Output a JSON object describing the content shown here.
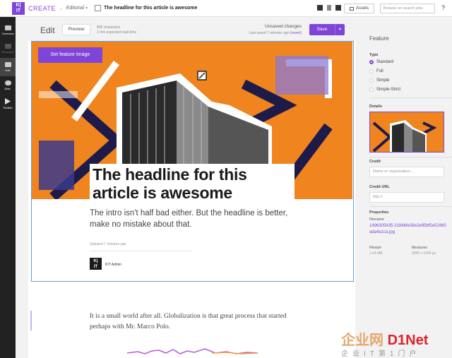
{
  "app": {
    "name": "CREATE",
    "logo_text_top": "K|",
    "logo_text_bottom": "IT"
  },
  "breadcrumb": {
    "section": "Editorial",
    "doc_title": "The headline for this article is awesome"
  },
  "topbar": {
    "assets_label": "Assets",
    "search_placeholder": "Browse on search jobs",
    "help": "?"
  },
  "nav": [
    {
      "label": "Overview",
      "icon": "eye-icon",
      "state": "normal"
    },
    {
      "label": "Research",
      "icon": "flask-icon",
      "state": "dim"
    },
    {
      "label": "Edit",
      "icon": "pencil-icon",
      "state": "active"
    },
    {
      "label": "Distr.",
      "icon": "cloud-icon",
      "state": "normal"
    },
    {
      "label": "Publish",
      "icon": "play-icon",
      "state": "normal"
    }
  ],
  "editor": {
    "title": "Edit",
    "preview_label": "Preview",
    "characters": "893 characters",
    "read_time": "1 min expected read time",
    "status": "Unsaved changes",
    "last_saved": "Last saved 7 minutes ago",
    "revert": "(revert)",
    "save_label": "Save"
  },
  "article": {
    "feature_button": "Set feature Image",
    "headline": "The headline for this article is awesome",
    "intro": "The intro isn't half bad either. But the headline is better, make no mistake about that.",
    "updated": "Updated 7 minutes ago",
    "author": "KIT Admin",
    "body": "It is a small world after all. Globalization is that great process that started perhaps with Mr. Marco Polo."
  },
  "sidebar": {
    "title": "Feature",
    "type_label": "Type",
    "types": [
      "Standard",
      "Full",
      "Simple",
      "Simple-Strict"
    ],
    "selected_type": "Standard",
    "details_label": "Details",
    "credit_label": "Credit",
    "credit_placeholder": "Name or organization...",
    "credit_url_label": "Credit URL",
    "credit_url_placeholder": "http://",
    "properties_label": "Properties",
    "filename_label": "Filename",
    "filename": "1496305435-2184bfe38e2e95bf5e51960ada4a1ca.jpg",
    "filesize_label": "Filesize",
    "filesize": "1.64 MB",
    "measures_label": "Measures",
    "measures": "2560 x 1434 px"
  },
  "watermark": {
    "top": "企业网",
    "brand": "D1Net",
    "bottom": "企业IT第1门户"
  },
  "colors": {
    "accent": "#7f45d8",
    "hero_orange": "#f0841e",
    "selection_blue": "#5ea0e4",
    "nav_bg": "#222222"
  }
}
